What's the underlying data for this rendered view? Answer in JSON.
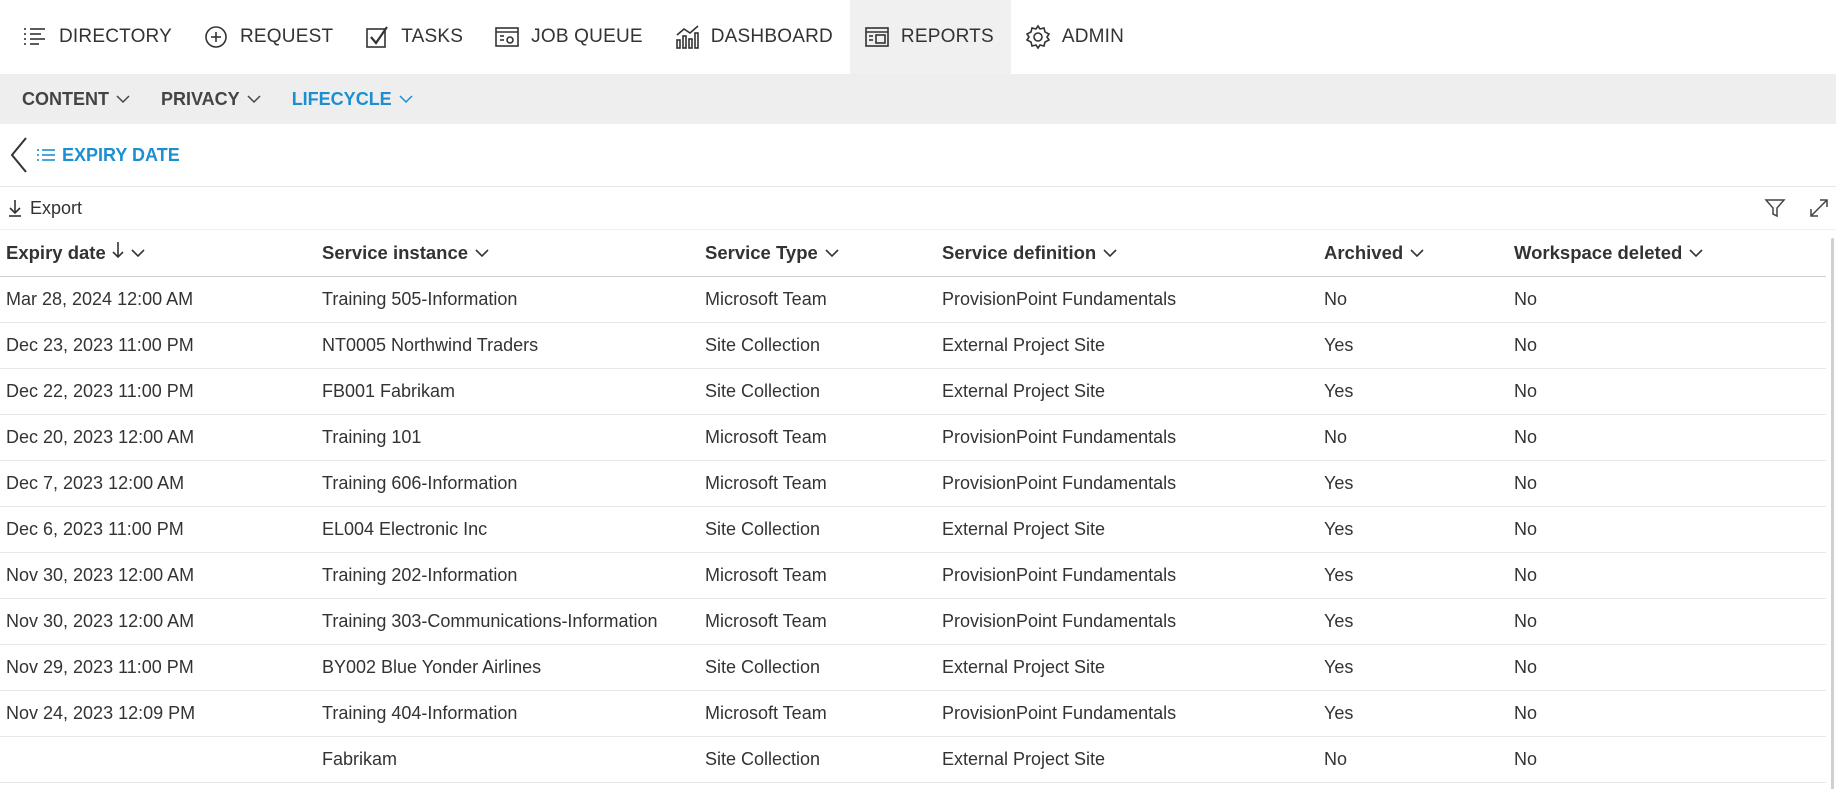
{
  "nav": {
    "items": [
      {
        "label": "DIRECTORY",
        "icon": "list-icon"
      },
      {
        "label": "REQUEST",
        "icon": "plus-circle-icon"
      },
      {
        "label": "TASKS",
        "icon": "checkbox-icon"
      },
      {
        "label": "JOB QUEUE",
        "icon": "job-queue-icon"
      },
      {
        "label": "DASHBOARD",
        "icon": "chart-icon"
      },
      {
        "label": "REPORTS",
        "icon": "reports-icon"
      },
      {
        "label": "ADMIN",
        "icon": "gear-icon"
      }
    ],
    "active": "REPORTS"
  },
  "subnav": {
    "items": [
      {
        "label": "CONTENT"
      },
      {
        "label": "PRIVACY"
      },
      {
        "label": "LIFECYCLE"
      }
    ],
    "active": "LIFECYCLE"
  },
  "breadcrumb": {
    "title": "EXPIRY DATE"
  },
  "toolbar": {
    "export_label": "Export"
  },
  "table": {
    "columns": [
      {
        "label": "Expiry date",
        "sorted": "descending"
      },
      {
        "label": "Service instance"
      },
      {
        "label": "Service Type"
      },
      {
        "label": "Service definition"
      },
      {
        "label": "Archived"
      },
      {
        "label": "Workspace deleted"
      }
    ],
    "rows": [
      [
        "Mar 28, 2024 12:00 AM",
        "Training 505-Information",
        "Microsoft Team",
        "ProvisionPoint Fundamentals",
        "No",
        "No"
      ],
      [
        "Dec 23, 2023 11:00 PM",
        "NT0005 Northwind Traders",
        "Site Collection",
        "External Project Site",
        "Yes",
        "No"
      ],
      [
        "Dec 22, 2023 11:00 PM",
        "FB001 Fabrikam",
        "Site Collection",
        "External Project Site",
        "Yes",
        "No"
      ],
      [
        "Dec 20, 2023 12:00 AM",
        "Training 101",
        "Microsoft Team",
        "ProvisionPoint Fundamentals",
        "No",
        "No"
      ],
      [
        "Dec 7, 2023 12:00 AM",
        "Training 606-Information",
        "Microsoft Team",
        "ProvisionPoint Fundamentals",
        "Yes",
        "No"
      ],
      [
        "Dec 6, 2023 11:00 PM",
        "EL004 Electronic Inc",
        "Site Collection",
        "External Project Site",
        "Yes",
        "No"
      ],
      [
        "Nov 30, 2023 12:00 AM",
        "Training 202-Information",
        "Microsoft Team",
        "ProvisionPoint Fundamentals",
        "Yes",
        "No"
      ],
      [
        "Nov 30, 2023 12:00 AM",
        "Training 303-Communications-Information",
        "Microsoft Team",
        "ProvisionPoint Fundamentals",
        "Yes",
        "No"
      ],
      [
        "Nov 29, 2023 11:00 PM",
        "BY002 Blue Yonder Airlines",
        "Site Collection",
        "External Project Site",
        "Yes",
        "No"
      ],
      [
        "Nov 24, 2023 12:09 PM",
        "Training 404-Information",
        "Microsoft Team",
        "ProvisionPoint Fundamentals",
        "Yes",
        "No"
      ],
      [
        "",
        "Fabrikam",
        "Site Collection",
        "External Project Site",
        "No",
        "No"
      ]
    ]
  },
  "colors": {
    "accent": "#1d8fd1",
    "subnav_bg": "#eeeeee",
    "active_tab_bg": "#f0f0f0"
  }
}
